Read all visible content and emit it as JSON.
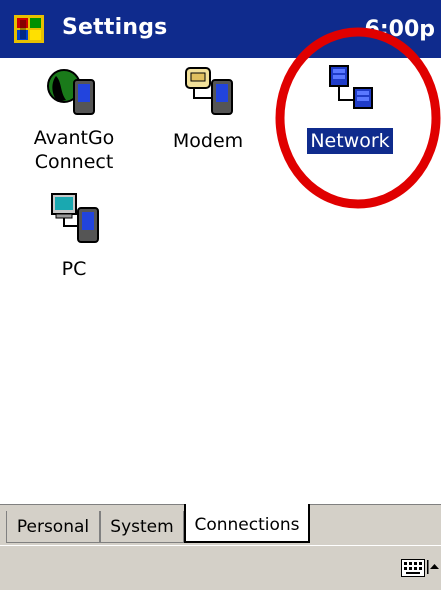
{
  "titlebar": {
    "title": "Settings",
    "time": "6:00p"
  },
  "apps": [
    {
      "label_line1": "AvantGo",
      "label_line2": "Connect",
      "icon": "avantgo-icon"
    },
    {
      "label": "Modem",
      "icon": "modem-icon"
    },
    {
      "label": "Network",
      "icon": "network-icon",
      "selected": true
    },
    {
      "label": "PC",
      "icon": "pc-icon"
    }
  ],
  "tabs": [
    {
      "label": "Personal"
    },
    {
      "label": "System"
    },
    {
      "label": "Connections",
      "active": true
    }
  ],
  "colors": {
    "titlebar": "#0f2b8d",
    "selection": "#0f2b8d",
    "annotation": "#e00000",
    "chrome": "#d4d0c8"
  }
}
